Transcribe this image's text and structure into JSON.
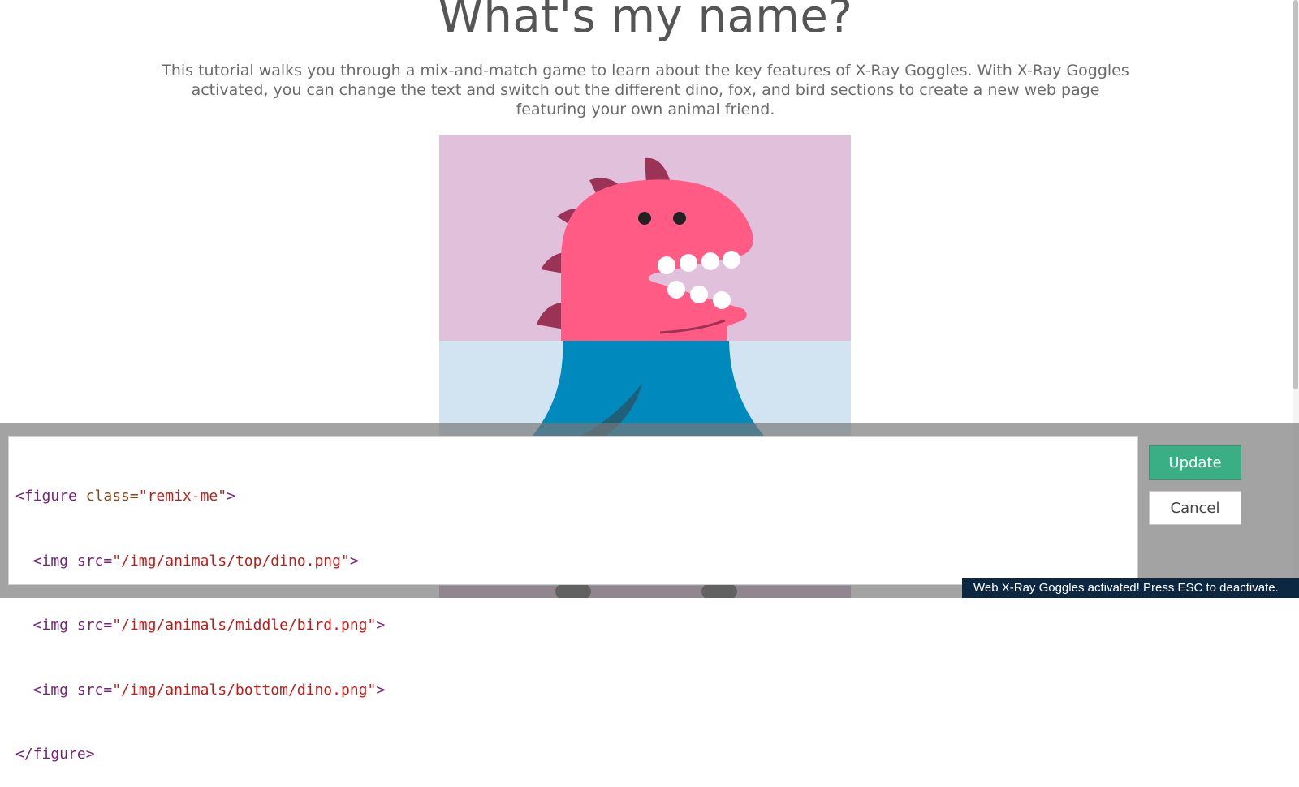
{
  "page": {
    "title": "What's my name?",
    "intro": "This tutorial walks you through a mix-and-match game to learn about the key features of X-Ray Goggles. With X-Ray Goggles activated, you can change the text and switch out the different dino, fox, and bird sections to create a new web page featuring your own animal friend."
  },
  "figure": {
    "top_image": "dino",
    "middle_image": "bird",
    "bottom_image": "dino",
    "colors": {
      "top_bg": "#e1c0dc",
      "middle_bg": "#d2e3f2",
      "dino_body": "#ff5b85",
      "dino_spikes": "#9a3355",
      "bird_body": "#0089bd",
      "bird_wing": "#205f78"
    }
  },
  "editor": {
    "lines": {
      "l1": {
        "open": "<figure ",
        "attr": "class=",
        "val": "\"remix-me\"",
        "close": ">"
      },
      "l2": {
        "open": "  <img ",
        "attr": "src=",
        "val": "\"/img/animals/top/dino.png\"",
        "close": ">"
      },
      "l3": {
        "open": "  <img ",
        "attr": "src=",
        "val": "\"/img/animals/middle/bird.png\"",
        "close": ">"
      },
      "l4": {
        "open": "  <img ",
        "attr": "src=",
        "val": "\"/img/animals/bottom/dino.png\"",
        "close": ">"
      },
      "l5": {
        "open": "</figure>"
      }
    }
  },
  "buttons": {
    "update": "Update",
    "cancel": "Cancel"
  },
  "status": {
    "message": "Web X-Ray Goggles activated! Press ESC to deactivate."
  },
  "colors": {
    "accent": "#3aaf85",
    "status_bg": "#0b2742",
    "overlay": "#787878"
  }
}
